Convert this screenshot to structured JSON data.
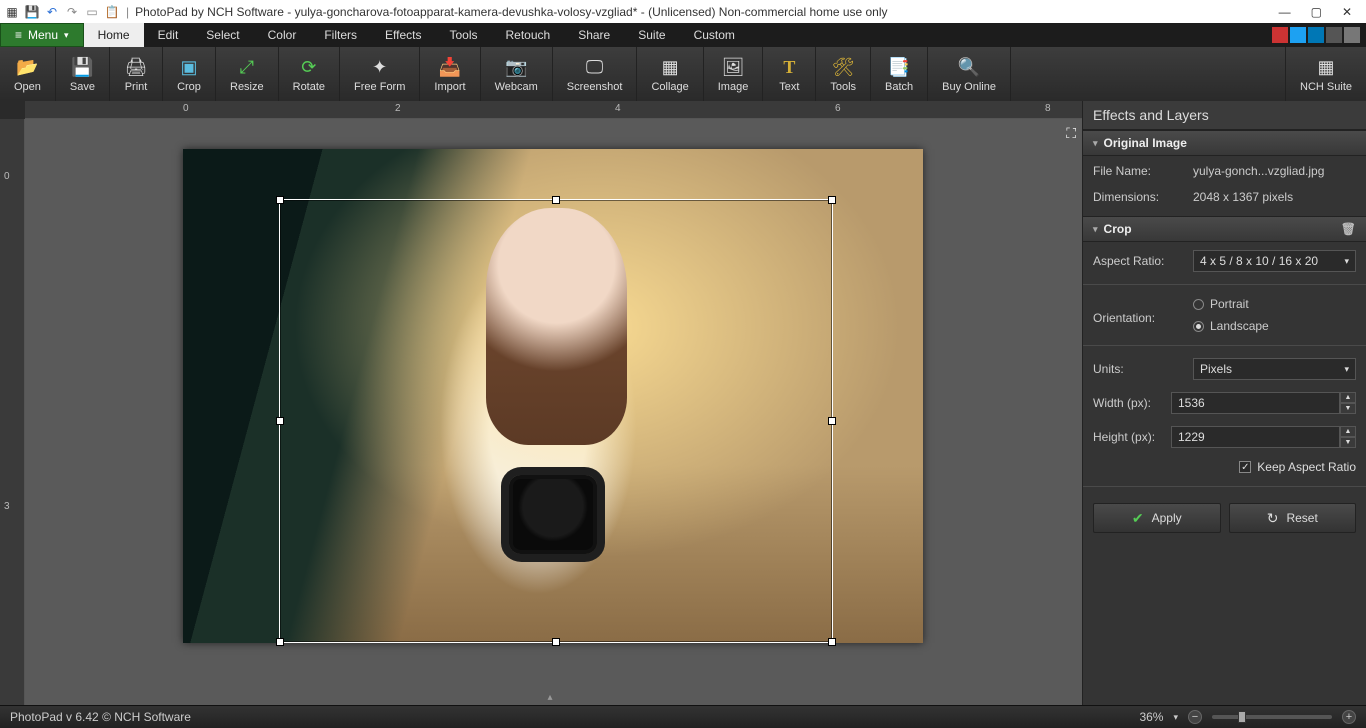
{
  "titlebar": {
    "app": "PhotoPad by NCH Software",
    "document": "yulya-goncharova-fotoapparat-kamera-devushka-volosy-vzgliad*",
    "license": "(Unlicensed) Non-commercial home use only"
  },
  "menu": {
    "button": "Menu",
    "tabs": [
      "Home",
      "Edit",
      "Select",
      "Color",
      "Filters",
      "Effects",
      "Tools",
      "Retouch",
      "Share",
      "Suite",
      "Custom"
    ],
    "active_tab": "Home"
  },
  "toolbar": {
    "items": [
      "Open",
      "Save",
      "Print",
      "Crop",
      "Resize",
      "Rotate",
      "Free Form",
      "Import",
      "Webcam",
      "Screenshot",
      "Collage",
      "Image",
      "Text",
      "Tools",
      "Batch",
      "Buy Online"
    ],
    "right_item": "NCH Suite",
    "icons": [
      "📂",
      "💾",
      "🖨",
      "▣",
      "⤢",
      "⟳",
      "✦",
      "📥",
      "📷",
      "🖵",
      "▦",
      "🖼",
      "T",
      "🛠",
      "📑",
      "🔍"
    ]
  },
  "ruler": {
    "h": [
      "0",
      "2",
      "4",
      "6",
      "8"
    ],
    "v": [
      "0",
      "3"
    ]
  },
  "panel": {
    "title": "Effects and Layers",
    "original": {
      "header": "Original Image",
      "filename_label": "File Name:",
      "filename": "yulya-gonch...vzgliad.jpg",
      "dimensions_label": "Dimensions:",
      "dimensions": "2048 x 1367 pixels"
    },
    "crop": {
      "header": "Crop",
      "aspect_label": "Aspect Ratio:",
      "aspect_value": "4 x 5 / 8 x 10 / 16 x 20",
      "orientation_label": "Orientation:",
      "portrait": "Portrait",
      "landscape": "Landscape",
      "orientation_selected": "landscape",
      "units_label": "Units:",
      "units_value": "Pixels",
      "width_label": "Width (px):",
      "width_value": "1536",
      "height_label": "Height (px):",
      "height_value": "1229",
      "keep_ratio": "Keep Aspect Ratio",
      "apply": "Apply",
      "reset": "Reset"
    }
  },
  "status": {
    "left": "PhotoPad v 6.42 © NCH Software",
    "zoom": "36%"
  }
}
